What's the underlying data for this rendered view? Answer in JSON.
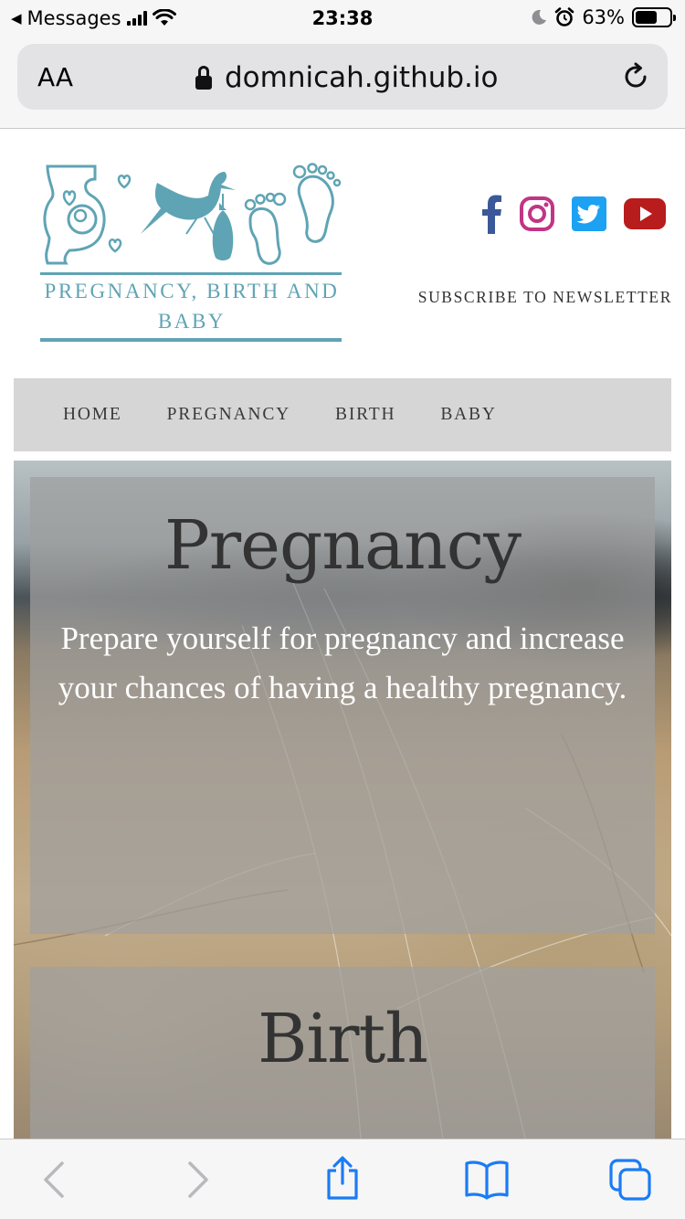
{
  "status_bar": {
    "back_app": "Messages",
    "time": "23:38",
    "battery": "63%",
    "battery_level": 0.63
  },
  "browser": {
    "text_size_label": "AA",
    "url": "domnicah.github.io"
  },
  "site": {
    "logo_text": "PREGNANCY, BIRTH AND BABY",
    "subscribe": "SUBSCRIBE TO NEWSLETTER",
    "social": [
      {
        "name": "facebook-icon",
        "color": "#3b5998"
      },
      {
        "name": "instagram-icon",
        "color": "#c13584"
      },
      {
        "name": "twitter-icon",
        "color": "#1da1f2"
      },
      {
        "name": "youtube-icon",
        "color": "#b91c1c"
      }
    ],
    "brand_color": "#5fa4b4"
  },
  "nav": {
    "items": [
      "HOME",
      "PREGNANCY",
      "BIRTH",
      "BABY"
    ]
  },
  "sections": [
    {
      "title": "Pregnancy",
      "text": "Prepare yourself for pregnancy and increase your chances of having a healthy pregnancy."
    },
    {
      "title": "Birth"
    }
  ]
}
